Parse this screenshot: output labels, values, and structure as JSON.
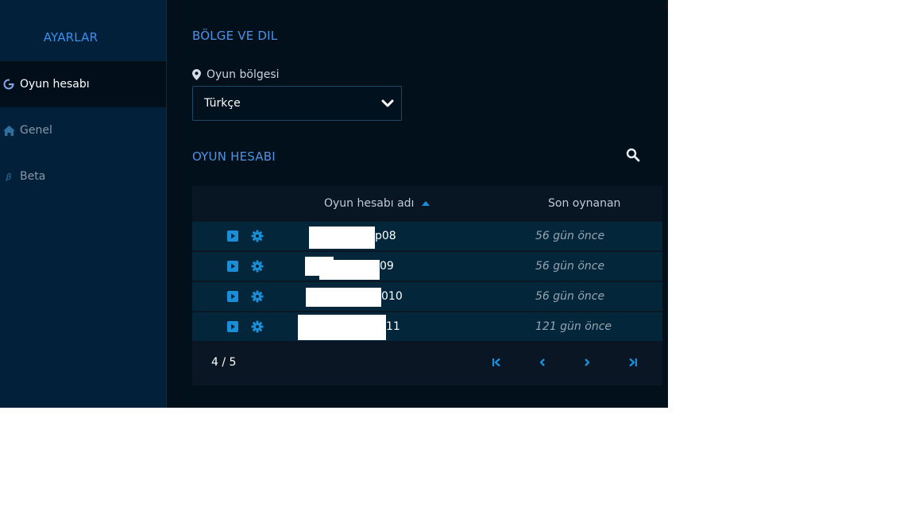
{
  "sidebar": {
    "title": "AYARLAR",
    "items": [
      {
        "label": "Oyun hesabı",
        "icon": "account-icon",
        "active": true
      },
      {
        "label": "Genel",
        "icon": "home-icon",
        "active": false
      },
      {
        "label": "Beta",
        "icon": "beta-icon",
        "active": false
      }
    ]
  },
  "region": {
    "section_title": "BÖLGE VE DIL",
    "label": "Oyun bölgesi",
    "selected": "Türkçe"
  },
  "accounts": {
    "section_title": "OYUN HESABI",
    "columns": {
      "name": "Oyun hesabı adı",
      "last_played": "Son oynanan"
    },
    "rows": [
      {
        "name_suffix": "p08",
        "last_played": "56 gün önce"
      },
      {
        "name_suffix": "09",
        "last_played": "56 gün önce"
      },
      {
        "name_suffix": "010",
        "last_played": "56 gün önce"
      },
      {
        "name_suffix": "11",
        "last_played": "121 gün önce"
      }
    ],
    "pagination": {
      "label": "4 / 5"
    }
  },
  "colors": {
    "accent": "#1a8fd8",
    "background": "#02101b",
    "sidebar": "#03203a",
    "row": "#03263b"
  }
}
